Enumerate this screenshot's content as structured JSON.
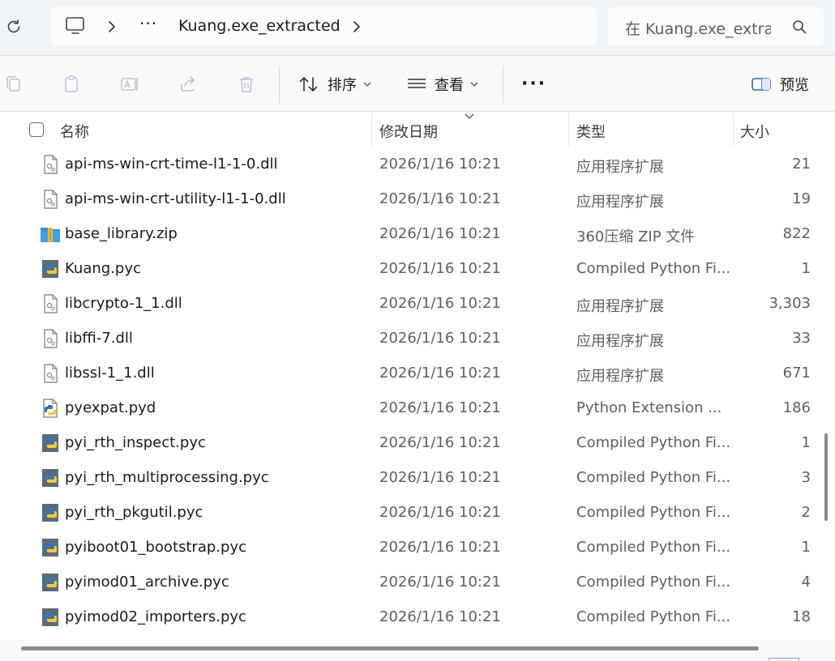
{
  "address_bar": {
    "overflow": "···",
    "path": "Kuang.exe_extracted",
    "search_placeholder": "在 Kuang.exe_extracted 中搜索",
    "search_visible": "在 Kuang.exe_extra"
  },
  "toolbar": {
    "sort_label": "排序",
    "view_label": "查看",
    "more_label": "···",
    "preview_label": "预览"
  },
  "columns": {
    "name": "名称",
    "date": "修改日期",
    "type": "类型",
    "size": "大小"
  },
  "rows": [
    {
      "name": "api-ms-win-crt-time-l1-1-0.dll",
      "date": "2026/1/16 10:21",
      "type": "应用程序扩展",
      "size": "21",
      "icon": "dll-file-icon"
    },
    {
      "name": "api-ms-win-crt-utility-l1-1-0.dll",
      "date": "2026/1/16 10:21",
      "type": "应用程序扩展",
      "size": "19",
      "icon": "dll-file-icon"
    },
    {
      "name": "base_library.zip",
      "date": "2026/1/16 10:21",
      "type": "360压缩 ZIP 文件",
      "size": "822",
      "icon": "zip-file-icon"
    },
    {
      "name": "Kuang.pyc",
      "date": "2026/1/16 10:21",
      "type": "Compiled Python Fi...",
      "size": "1",
      "icon": "pyc-file-icon"
    },
    {
      "name": "libcrypto-1_1.dll",
      "date": "2026/1/16 10:21",
      "type": "应用程序扩展",
      "size": "3,303",
      "icon": "dll-file-icon"
    },
    {
      "name": "libffi-7.dll",
      "date": "2026/1/16 10:21",
      "type": "应用程序扩展",
      "size": "33",
      "icon": "dll-file-icon"
    },
    {
      "name": "libssl-1_1.dll",
      "date": "2026/1/16 10:21",
      "type": "应用程序扩展",
      "size": "671",
      "icon": "dll-file-icon"
    },
    {
      "name": "pyexpat.pyd",
      "date": "2026/1/16 10:21",
      "type": "Python Extension ...",
      "size": "186",
      "icon": "pyd-file-icon"
    },
    {
      "name": "pyi_rth_inspect.pyc",
      "date": "2026/1/16 10:21",
      "type": "Compiled Python Fi...",
      "size": "1",
      "icon": "pyc-file-icon"
    },
    {
      "name": "pyi_rth_multiprocessing.pyc",
      "date": "2026/1/16 10:21",
      "type": "Compiled Python Fi...",
      "size": "3",
      "icon": "pyc-file-icon"
    },
    {
      "name": "pyi_rth_pkgutil.pyc",
      "date": "2026/1/16 10:21",
      "type": "Compiled Python Fi...",
      "size": "2",
      "icon": "pyc-file-icon"
    },
    {
      "name": "pyiboot01_bootstrap.pyc",
      "date": "2026/1/16 10:21",
      "type": "Compiled Python Fi...",
      "size": "1",
      "icon": "pyc-file-icon"
    },
    {
      "name": "pyimod01_archive.pyc",
      "date": "2026/1/16 10:21",
      "type": "Compiled Python Fi...",
      "size": "4",
      "icon": "pyc-file-icon"
    },
    {
      "name": "pyimod02_importers.pyc",
      "date": "2026/1/16 10:21",
      "type": "Compiled Python Fi...",
      "size": "18",
      "icon": "pyc-file-icon"
    }
  ],
  "colors": {
    "python_blue": "#3a75b0",
    "python_yellow": "#f6c93c",
    "zip_blue": "#2f8fe0",
    "zip_yellow": "#f3b92b"
  }
}
